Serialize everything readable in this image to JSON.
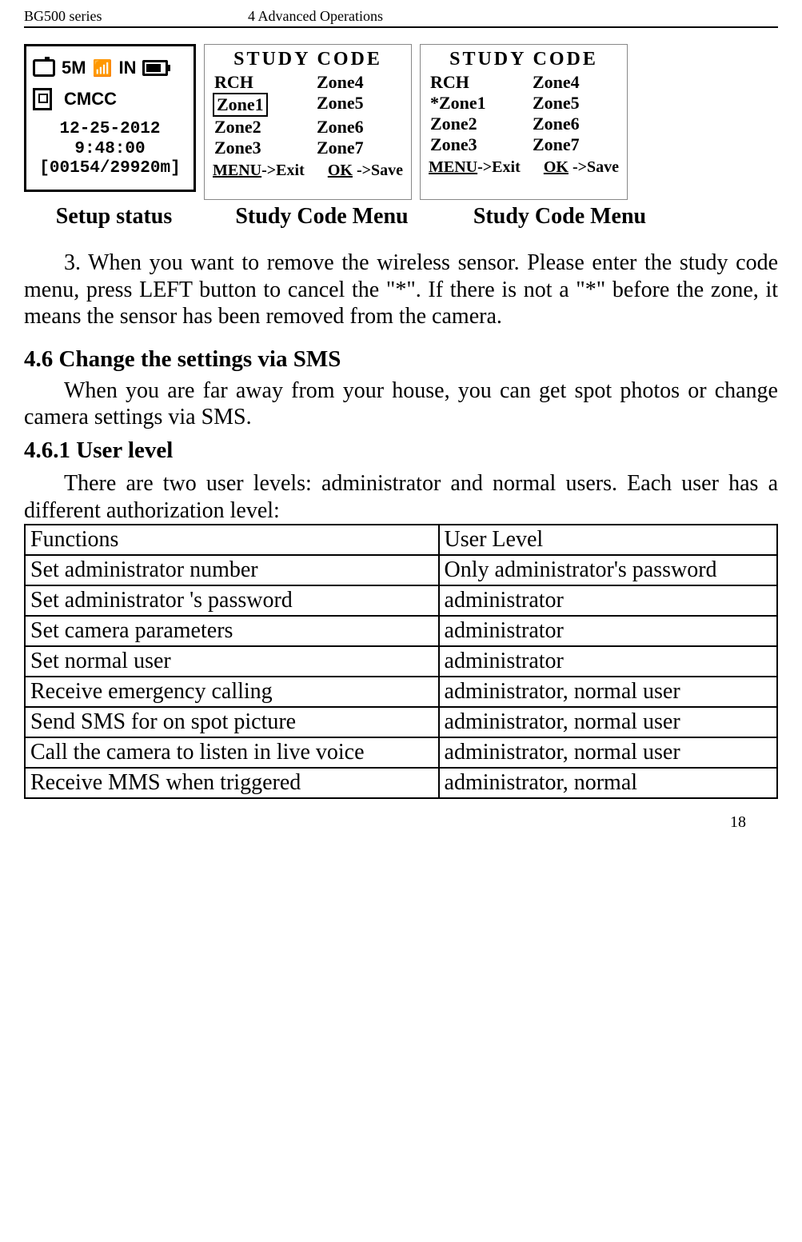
{
  "header": {
    "left": "BG500 series",
    "center": "4 Advanced Operations"
  },
  "lcd": {
    "row1_5m": "5M",
    "row1_in": "IN",
    "row2_carrier": "CMCC",
    "date": "12-25-2012",
    "time": "9:48:00",
    "counter": "[00154/29920m]"
  },
  "menu1": {
    "title": "STUDY  CODE",
    "cells": [
      "RCH",
      "Zone4",
      "Zone1",
      "Zone5",
      "Zone2",
      "Zone6",
      "Zone3",
      "Zone7"
    ],
    "footer_menu": "MENU",
    "footer_menu_suffix": "->Exit",
    "footer_ok": "OK",
    "footer_ok_suffix": "->Save"
  },
  "menu2": {
    "title": "STUDY  CODE",
    "cells": [
      "RCH",
      "Zone4",
      "*Zone1",
      "Zone5",
      "Zone2",
      "Zone6",
      "Zone3",
      "Zone7"
    ],
    "footer_menu": "MENU",
    "footer_menu_suffix": "->Exit",
    "footer_ok": "OK",
    "footer_ok_suffix": "->Save"
  },
  "captions": {
    "c1": "Setup status",
    "c2": "Study Code Menu",
    "c3": "Study Code Menu"
  },
  "paragraph3": "3. When you want to remove the wireless sensor. Please enter the study code menu, press LEFT button to cancel the \"*\". If there is not a \"*\" before the zone, it means the sensor has been removed from the camera.",
  "section46": "4.6  Change the settings via SMS",
  "section46_body": "When you are far away from your house, you can get spot photos or change camera settings via SMS.",
  "section461": "4.6.1 User level",
  "section461_body": "There are two user levels: administrator and normal users. Each user has a different authorization level:",
  "table": {
    "rows": [
      [
        "Functions",
        "User Level"
      ],
      [
        "Set administrator number",
        "Only administrator's password"
      ],
      [
        "Set administrator 's password",
        "administrator"
      ],
      [
        "Set camera parameters",
        "administrator"
      ],
      [
        "Set normal user",
        "administrator"
      ],
      [
        "Receive emergency calling",
        "administrator, normal user"
      ],
      [
        "Send SMS for on spot picture",
        "administrator, normal user"
      ],
      [
        "Call the camera to listen in live voice",
        "administrator, normal user"
      ],
      [
        "Receive MMS when triggered",
        "administrator, normal"
      ]
    ]
  },
  "page_number": "18"
}
